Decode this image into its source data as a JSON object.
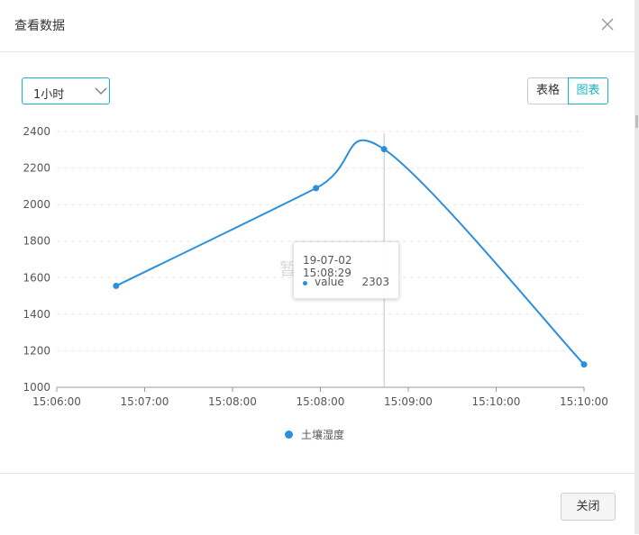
{
  "dialog": {
    "title": "查看数据"
  },
  "controls": {
    "range_select": {
      "value": "1小时"
    },
    "view_toggle": {
      "table_label": "表格",
      "chart_label": "图表",
      "active": "图表"
    }
  },
  "chart_data": {
    "type": "line",
    "x_tick_labels": [
      "15:06:00",
      "15:07:00",
      "15:08:00",
      "15:08:00",
      "15:09:00",
      "15:10:00",
      "15:10:00"
    ],
    "y_ticks": [
      1000,
      1200,
      1400,
      1600,
      1800,
      2000,
      2200,
      2400
    ],
    "ylim": [
      1000,
      2400
    ],
    "xlim": [
      "15:06:00",
      "15:10:00"
    ],
    "grid": "dashed-horizontal",
    "series": [
      {
        "name": "土壤湿度",
        "color": "#2c8fde",
        "smooth": true,
        "points": [
          {
            "x": "15:06:27",
            "y": 1555
          },
          {
            "x": "15:07:58",
            "y": 2090
          },
          {
            "x": "15:08:29",
            "y": 2303
          },
          {
            "x": "15:10:00",
            "y": 1125
          }
        ]
      }
    ],
    "legend_position": "bottom-center",
    "tooltip": {
      "time": "19-07-02 15:08:29",
      "series_label": "value",
      "value": "2303"
    },
    "watermark": "暂"
  },
  "footer": {
    "close_label": "关闭"
  }
}
